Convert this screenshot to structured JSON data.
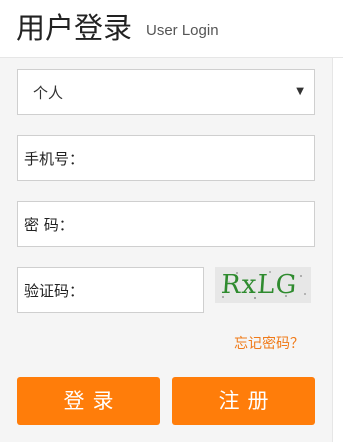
{
  "header": {
    "title": "用户登录",
    "subtitle": "User Login"
  },
  "form": {
    "account_type": {
      "selected": "个人",
      "arrow_icon": "triangle-down-icon"
    },
    "phone_label": "手机号：",
    "password_label": "密 码：",
    "code_label": "验证码：",
    "captcha_text": "RxLG",
    "forgot_link": "忘记密码？",
    "login_button": "登录",
    "register_button": "注册"
  },
  "colors": {
    "accent": "#ff7d0a",
    "link": "#f07a18",
    "captcha_text": "#2f8b2f",
    "panel_bg": "#f5f5f5"
  }
}
